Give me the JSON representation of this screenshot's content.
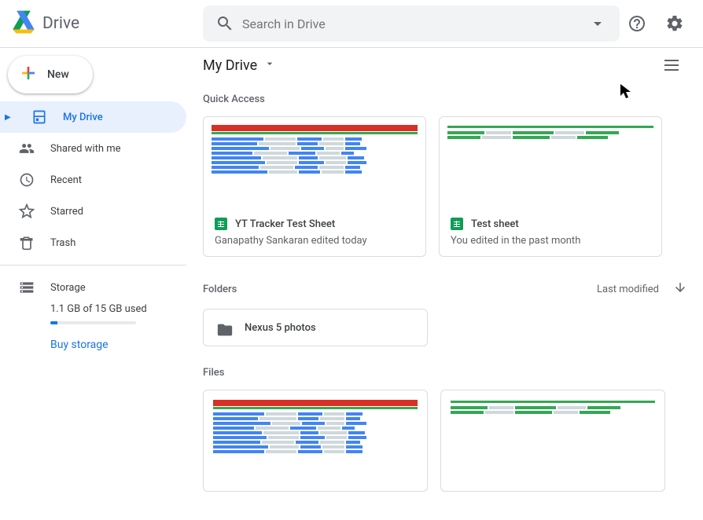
{
  "header": {
    "app_name": "Drive",
    "search_placeholder": "Search in Drive"
  },
  "new_button_label": "New",
  "nav": {
    "my_drive": "My Drive",
    "shared": "Shared with me",
    "recent": "Recent",
    "starred": "Starred",
    "trash": "Trash",
    "storage": "Storage"
  },
  "storage": {
    "summary": "1.1 GB of 15 GB used",
    "buy_label": "Buy storage"
  },
  "toolbar": {
    "breadcrumb": "My Drive"
  },
  "sections": {
    "quick_access": "Quick Access",
    "folders": "Folders",
    "files": "Files",
    "sort_label": "Last modified"
  },
  "quick_access": [
    {
      "title": "YT Tracker Test Sheet",
      "subtitle": "Ganapathy Sankaran edited today"
    },
    {
      "title": "Test sheet",
      "subtitle": "You edited in the past month"
    }
  ],
  "folders": [
    {
      "name": "Nexus 5 photos"
    }
  ]
}
